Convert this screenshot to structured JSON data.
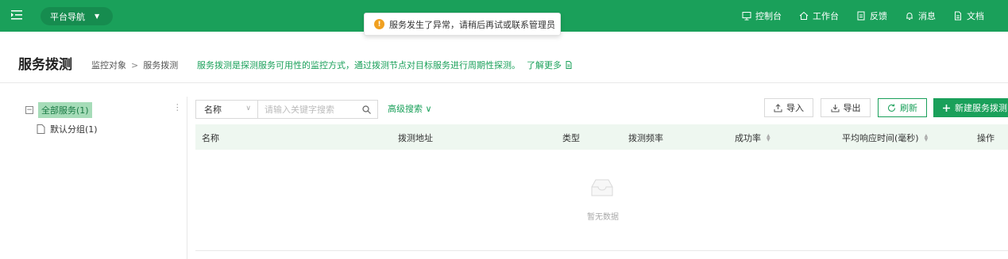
{
  "topbar": {
    "platform_nav": "平台导航",
    "links": [
      {
        "label": "控制台",
        "icon": "monitor-icon"
      },
      {
        "label": "工作台",
        "icon": "home-icon"
      },
      {
        "label": "反馈",
        "icon": "feedback-icon"
      },
      {
        "label": "消息",
        "icon": "bell-icon"
      },
      {
        "label": "文档",
        "icon": "document-icon"
      }
    ]
  },
  "toast": {
    "message": "服务发生了异常，请稍后再试或联系管理员",
    "icon": "warning-icon"
  },
  "header": {
    "title": "服务拨测",
    "breadcrumb": [
      "监控对象",
      "服务拨测"
    ],
    "description": "服务拨测是探测服务可用性的监控方式，通过拨测节点对目标服务进行周期性探测。",
    "learn_more": "了解更多"
  },
  "tree": {
    "root": "全部服务(1)",
    "children": [
      "默认分组(1)"
    ]
  },
  "toolbar": {
    "field_select": "名称",
    "search_placeholder": "请输入关键字搜索",
    "advanced_search": "高级搜索",
    "import": "导入",
    "export": "导出",
    "refresh": "刷新",
    "new": "新建服务拨测"
  },
  "table": {
    "columns": [
      "名称",
      "拨测地址",
      "类型",
      "拨测频率",
      "成功率",
      "平均响应时间(毫秒)",
      "操作"
    ],
    "empty_text": "暂无数据"
  },
  "colors": {
    "brand": "#1aa05a",
    "warning": "#f0a020"
  }
}
